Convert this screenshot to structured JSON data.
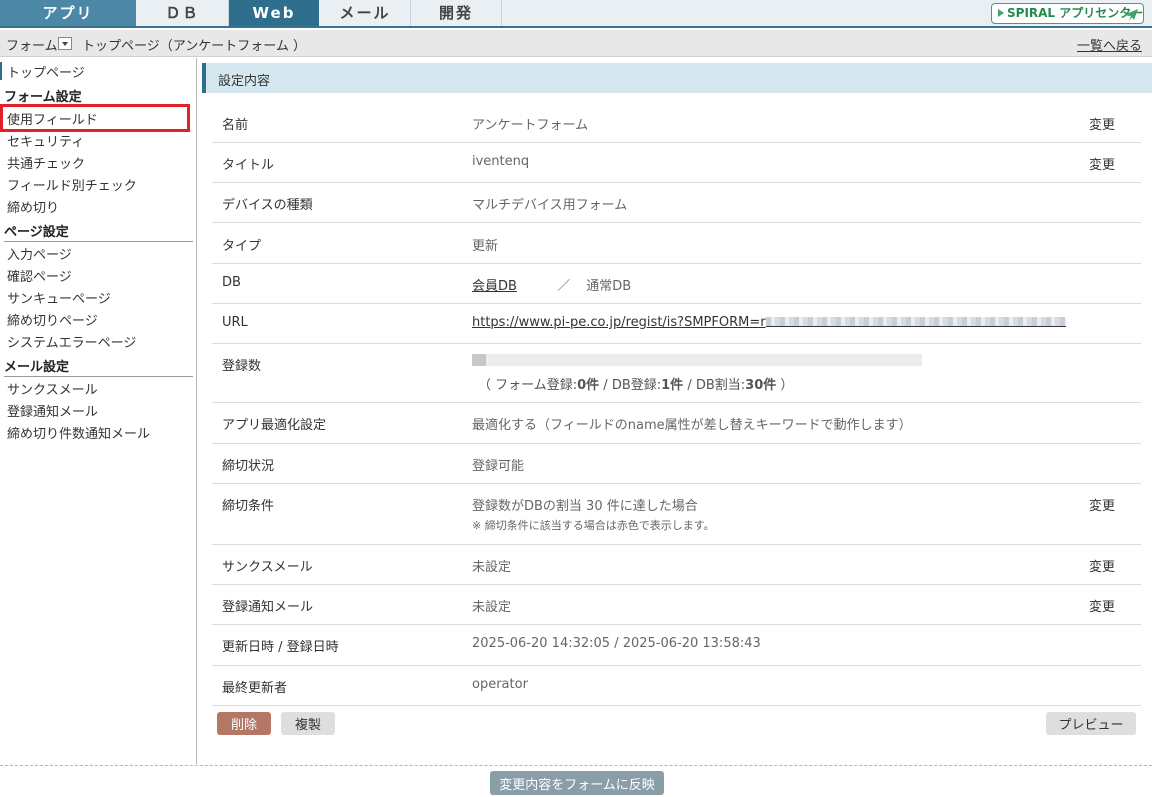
{
  "nav": {
    "tabs": [
      "アプリ",
      "ＤＢ",
      "Web",
      "メール",
      "開発"
    ],
    "active": "Web",
    "appcenter_label": "SPIRAL アプリセンター"
  },
  "breadcrumb": {
    "form_label": "フォーム",
    "page_label": "トップページ（アンケートフォーム ）",
    "back_link": "一覧へ戻る"
  },
  "sidebar": {
    "top_item": "トップページ",
    "form_settings": {
      "heading": "フォーム設定",
      "items": [
        "使用フィールド",
        "セキュリティ",
        "共通チェック",
        "フィールド別チェック",
        "締め切り"
      ]
    },
    "page_settings": {
      "heading": "ページ設定",
      "items": [
        "入力ページ",
        "確認ページ",
        "サンキューページ",
        "締め切りページ",
        "システムエラーページ"
      ]
    },
    "mail_settings": {
      "heading": "メール設定",
      "items": [
        "サンクスメール",
        "登録通知メール",
        "締め切り件数通知メール"
      ]
    },
    "highlighted_item": "使用フィールド"
  },
  "main": {
    "section_title": "設定内容",
    "change_label": "変更",
    "rows": {
      "name": {
        "label": "名前",
        "value": "アンケートフォーム"
      },
      "title": {
        "label": "タイトル",
        "value": "iventenq"
      },
      "device": {
        "label": "デバイスの種類",
        "value": "マルチデバイス用フォーム"
      },
      "type": {
        "label": "タイプ",
        "value": "更新"
      },
      "db": {
        "label": "DB",
        "link": "会員DB",
        "separator": "／",
        "value": "通常DB"
      },
      "url": {
        "label": "URL",
        "value": "https://www.pi-pe.co.jp/regist/is?SMPFORM=r"
      },
      "count": {
        "label": "登録数",
        "progress_fraction": 0.03,
        "open": "（ フォーム登録:",
        "form_count": "0件",
        "mid1": " / DB登録:",
        "db_count": "1件",
        "mid2": " / DB割当:",
        "quota": "30件",
        "close": " ）"
      },
      "app_opt": {
        "label": "アプリ最適化設定",
        "value": "最適化する（フィールドのname属性が差し替えキーワードで動作します）"
      },
      "close_status": {
        "label": "締切状況",
        "value": "登録可能"
      },
      "close_cond": {
        "label": "締切条件",
        "value": "登録数がDBの割当 30 件に達した場合",
        "note": "※ 締切条件に該当する場合は赤色で表示します。"
      },
      "thanks_mail": {
        "label": "サンクスメール",
        "value": "未設定"
      },
      "notify_mail": {
        "label": "登録通知メール",
        "value": "未設定"
      },
      "updated": {
        "label": "更新日時 / 登録日時",
        "value": "2025-06-20 14:32:05 / 2025-06-20 13:58:43"
      },
      "last_editor": {
        "label": "最終更新者",
        "value": "operator"
      }
    }
  },
  "buttons": {
    "delete": "削除",
    "copy": "複製",
    "preview": "プレビュー",
    "apply": "変更内容をフォームに反映"
  },
  "colors": {
    "accent": "#2f6e8d",
    "highlight_box": "#e2202a",
    "delete_button": "#b57765"
  }
}
